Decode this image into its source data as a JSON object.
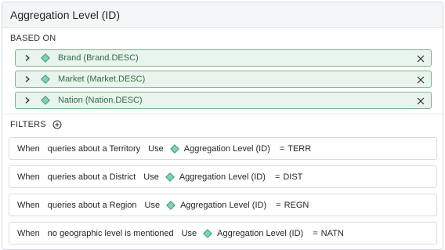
{
  "panel": {
    "title": "Aggregation Level (ID)"
  },
  "based_on": {
    "label": "BASED ON",
    "items": [
      {
        "label": "Brand (Brand.DESC)"
      },
      {
        "label": "Market (Market.DESC)"
      },
      {
        "label": "Nation (Nation.DESC)"
      }
    ]
  },
  "filters": {
    "label": "FILTERS",
    "rules": [
      {
        "when": "When",
        "condition": "queries about a Territory",
        "use": "Use",
        "field": "Aggregation Level (ID)",
        "op": "=",
        "value": "TERR"
      },
      {
        "when": "When",
        "condition": "queries about a District",
        "use": "Use",
        "field": "Aggregation Level (ID)",
        "op": "=",
        "value": "DIST"
      },
      {
        "when": "When",
        "condition": "queries about a Region",
        "use": "Use",
        "field": "Aggregation Level (ID)",
        "op": "=",
        "value": "REGN"
      },
      {
        "when": "When",
        "condition": "no geographic level is mentioned",
        "use": "Use",
        "field": "Aggregation Level (ID)",
        "op": "=",
        "value": "NATN"
      }
    ]
  },
  "icons": {
    "expand": "chevron-right-icon",
    "dimension": "diamond-icon",
    "remove": "close-icon",
    "add": "plus-circle-icon"
  },
  "colors": {
    "chip_bg": "#e9f4ec",
    "chip_border": "#7fb68e",
    "chip_text": "#2e6e46",
    "diamond_fill": "#7fd1b9",
    "diamond_stroke": "#3d9a7e"
  }
}
